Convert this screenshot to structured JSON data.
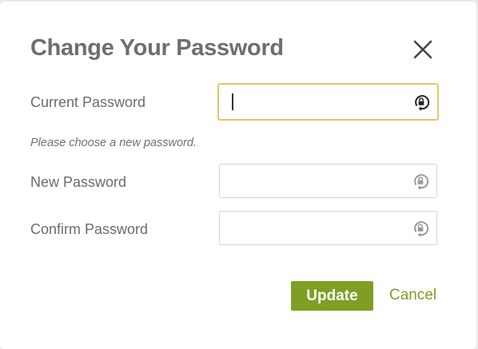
{
  "dialog": {
    "title": "Change Your Password",
    "close_icon": "close-icon"
  },
  "fields": {
    "current": {
      "label": "Current Password",
      "value": "",
      "placeholder": "",
      "icon": "password-visibility-icon"
    },
    "new": {
      "label": "New Password",
      "value": "",
      "placeholder": "",
      "icon": "password-visibility-icon"
    },
    "confirm": {
      "label": "Confirm Password",
      "value": "",
      "placeholder": "",
      "icon": "password-visibility-icon"
    }
  },
  "hint": "Please choose a new password.",
  "buttons": {
    "update": "Update",
    "cancel": "Cancel"
  },
  "colors": {
    "accent": "#7e9f24",
    "focus_border": "#e5c56c",
    "title": "#6e6e6e"
  }
}
